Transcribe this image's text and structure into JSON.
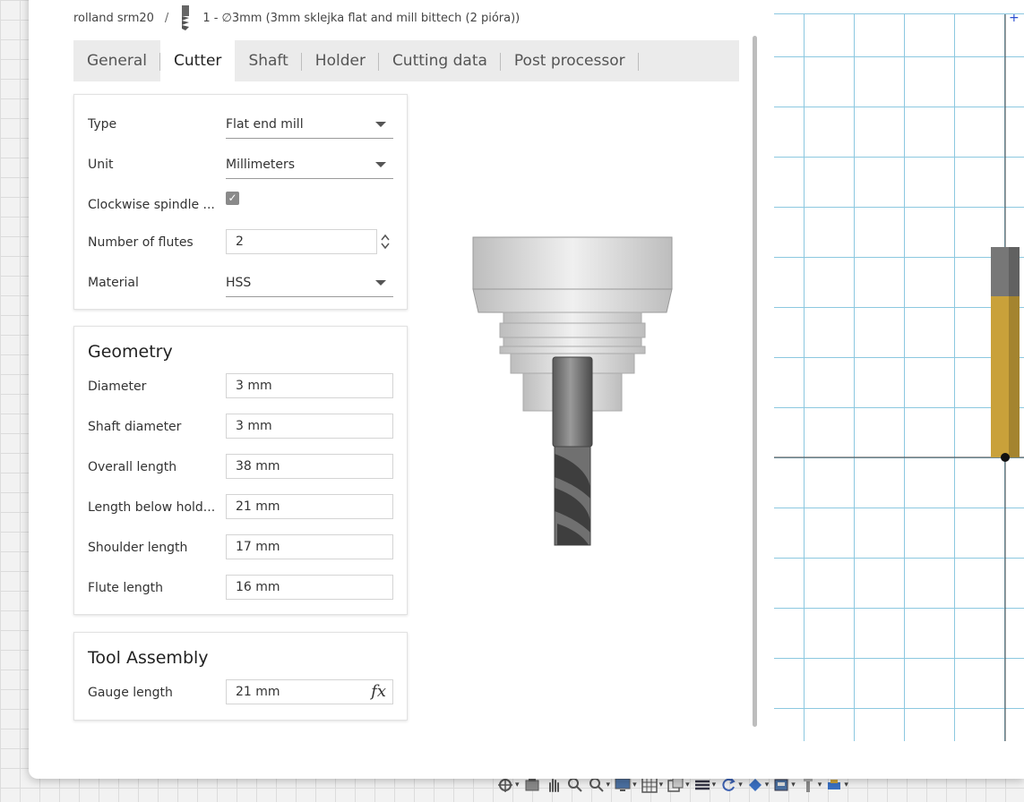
{
  "breadcrumb": {
    "machine": "rolland srm20",
    "separator": "/",
    "tool": "1 - ∅3mm (3mm sklejka flat and mill bittech (2 pióra))"
  },
  "tabs": [
    {
      "label": "General"
    },
    {
      "label": "Cutter"
    },
    {
      "label": "Shaft"
    },
    {
      "label": "Holder"
    },
    {
      "label": "Cutting data"
    },
    {
      "label": "Post processor"
    }
  ],
  "active_tab": "Cutter",
  "cutter": {
    "type_label": "Type",
    "type_value": "Flat end mill",
    "unit_label": "Unit",
    "unit_value": "Millimeters",
    "clockwise_label": "Clockwise spindle ...",
    "clockwise_checked": "✓",
    "flutes_label": "Number of flutes",
    "flutes_value": "2",
    "material_label": "Material",
    "material_value": "HSS"
  },
  "geometry": {
    "title": "Geometry",
    "diameter_label": "Diameter",
    "diameter_value": "3 mm",
    "shaft_diameter_label": "Shaft diameter",
    "shaft_diameter_value": "3 mm",
    "overall_length_label": "Overall length",
    "overall_length_value": "38 mm",
    "length_below_label": "Length below hold...",
    "length_below_value": "21 mm",
    "shoulder_length_label": "Shoulder length",
    "shoulder_length_value": "17 mm",
    "flute_length_label": "Flute length",
    "flute_length_value": "16 mm"
  },
  "assembly": {
    "title": "Tool Assembly",
    "gauge_label": "Gauge length",
    "gauge_value": "21 mm",
    "fx_label": "fx"
  },
  "colors": {
    "grid_line": "#8cc8e0",
    "tool_body": "#c9a13a",
    "accent_blue": "#2a4fd0"
  }
}
